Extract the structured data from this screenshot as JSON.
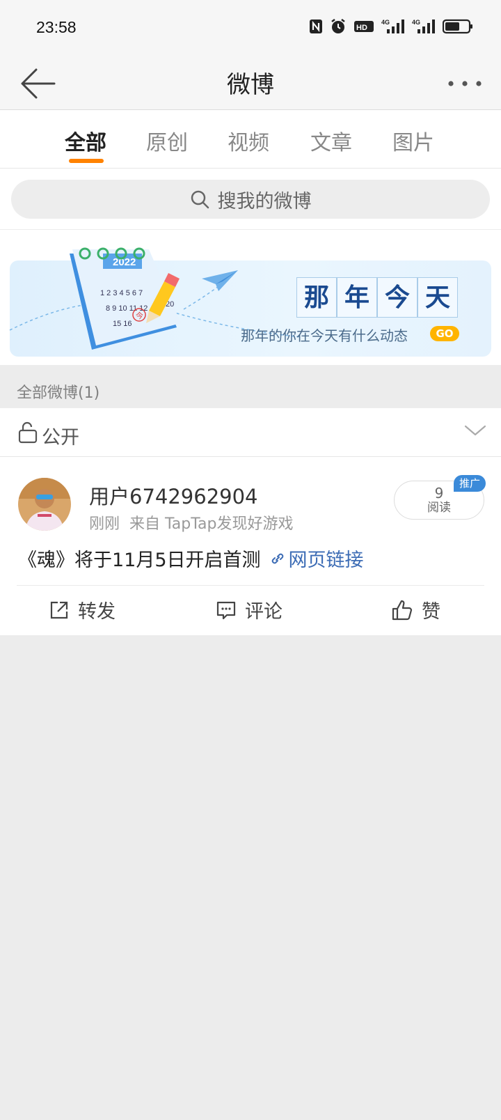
{
  "status_bar": {
    "time": "23:58",
    "net_4g_1": "4G",
    "net_4g_2": "4G",
    "hd_label": "HD"
  },
  "nav": {
    "title": "微博"
  },
  "tabs": [
    {
      "label": "全部",
      "active": true
    },
    {
      "label": "原创"
    },
    {
      "label": "视频"
    },
    {
      "label": "文章"
    },
    {
      "label": "图片"
    }
  ],
  "search": {
    "placeholder": "搜我的微博"
  },
  "banner": {
    "calendar_year": "2022",
    "title_chars": [
      "那",
      "年",
      "今",
      "天"
    ],
    "subtitle": "那年的你在今天有什么动态",
    "go_label": "GO",
    "calendar_numbers": "1 2 3 4 5 6 7",
    "calendar_row_2": "8 9 10 11 12",
    "calendar_row_3": "15 16",
    "calendar_badge": "今",
    "calendar_20": "20"
  },
  "section": {
    "title": "全部微博(1)"
  },
  "filter": {
    "label": "公开"
  },
  "post": {
    "username": "用户6742962904",
    "time": "刚刚",
    "source": "来自 TapTap发现好游戏",
    "read_count": "9",
    "read_label": "阅读",
    "promo_label": "推广",
    "text": "《魂》将于11月5日开启首测",
    "link_text": "网页链接",
    "actions": {
      "repost": "转发",
      "comment": "评论",
      "like": "赞"
    }
  }
}
